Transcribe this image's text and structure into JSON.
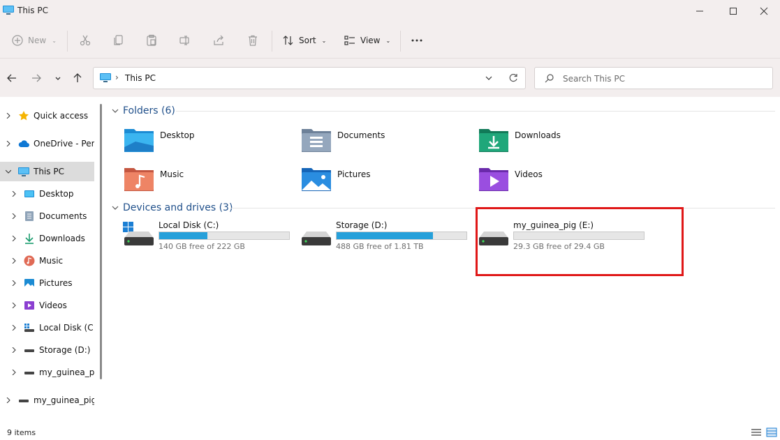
{
  "window": {
    "title": "This PC"
  },
  "toolbar": {
    "new_label": "New",
    "sort_label": "Sort",
    "view_label": "View"
  },
  "address": {
    "path": "This PC"
  },
  "search": {
    "placeholder": "Search This PC"
  },
  "sidebar": {
    "items": [
      {
        "label": "Quick access",
        "icon": "star-icon"
      },
      {
        "label": "OneDrive - Perso",
        "icon": "cloud-icon"
      },
      {
        "label": "This PC",
        "icon": "computer-icon",
        "selected": true
      },
      {
        "label": "Desktop",
        "icon": "desktop-folder-icon"
      },
      {
        "label": "Documents",
        "icon": "documents-icon"
      },
      {
        "label": "Downloads",
        "icon": "download-icon"
      },
      {
        "label": "Music",
        "icon": "music-icon"
      },
      {
        "label": "Pictures",
        "icon": "pictures-icon"
      },
      {
        "label": "Videos",
        "icon": "videos-icon"
      },
      {
        "label": "Local Disk (C:)",
        "icon": "windows-drive-icon"
      },
      {
        "label": "Storage (D:)",
        "icon": "drive-icon"
      },
      {
        "label": "my_guinea_pig",
        "icon": "drive-icon"
      },
      {
        "label": "my_guinea_pig (",
        "icon": "drive-icon"
      }
    ]
  },
  "folders": {
    "header": "Folders (6)",
    "items": [
      {
        "label": "Desktop",
        "icon": "desktop-folder-icon"
      },
      {
        "label": "Documents",
        "icon": "documents-folder-icon"
      },
      {
        "label": "Downloads",
        "icon": "downloads-folder-icon"
      },
      {
        "label": "Music",
        "icon": "music-folder-icon"
      },
      {
        "label": "Pictures",
        "icon": "pictures-folder-icon"
      },
      {
        "label": "Videos",
        "icon": "videos-folder-icon"
      }
    ]
  },
  "drives": {
    "header": "Devices and drives (3)",
    "items": [
      {
        "label": "Local Disk (C:)",
        "free": "140 GB free of 222 GB",
        "used_fraction": 0.37,
        "icon": "windows-drive-icon"
      },
      {
        "label": "Storage (D:)",
        "free": "488 GB free of 1.81 TB",
        "used_fraction": 0.74,
        "icon": "drive-icon"
      },
      {
        "label": "my_guinea_pig (E:)",
        "free": "29.3 GB free of 29.4 GB",
        "used_fraction": 0.0,
        "icon": "drive-icon"
      }
    ]
  },
  "status": {
    "count": "9 items"
  },
  "colors": {
    "accent": "#26a0da",
    "highlight": "#e01818",
    "group_header": "#1f4f8a"
  }
}
